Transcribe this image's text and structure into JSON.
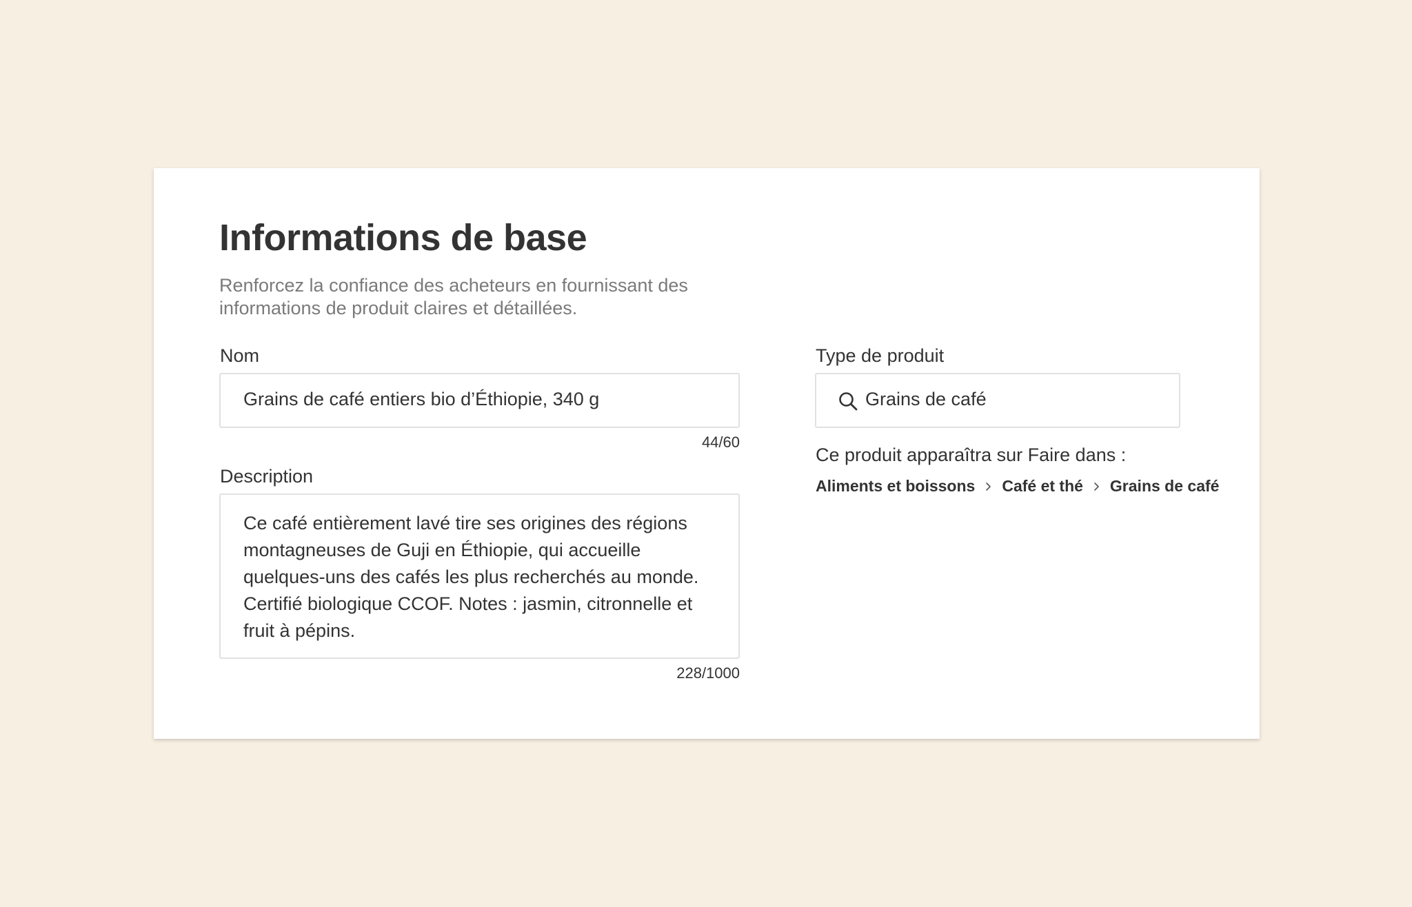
{
  "section": {
    "title": "Informations de base",
    "subtitle": "Renforcez la confiance des acheteurs en fournissant des informations de produit claires et détaillées."
  },
  "name_field": {
    "label": "Nom",
    "value": "Grains de café entiers bio d’Éthiopie, 340 g",
    "counter": "44/60"
  },
  "description_field": {
    "label": "Description",
    "value": "Ce café entièrement lavé tire ses origines des régions montagneuses de Guji en Éthiopie, qui accueille quelques-uns des cafés les plus recherchés au monde. Certifié biologique CCOF. Notes : jasmin, citronnelle et fruit à pépins.",
    "counter": "228/1000"
  },
  "product_type_field": {
    "label": "Type de produit",
    "value": "Grains de café",
    "icon": "search-icon"
  },
  "category_hint": {
    "text": "Ce produit apparaîtra sur Faire dans :",
    "breadcrumb": [
      "Aliments et boissons",
      "Café et thé",
      "Grains de café"
    ]
  },
  "colors": {
    "background": "#f7efe2",
    "card": "#ffffff",
    "text": "#333333",
    "muted": "#7a7a7a",
    "border": "#e1e1e1"
  }
}
